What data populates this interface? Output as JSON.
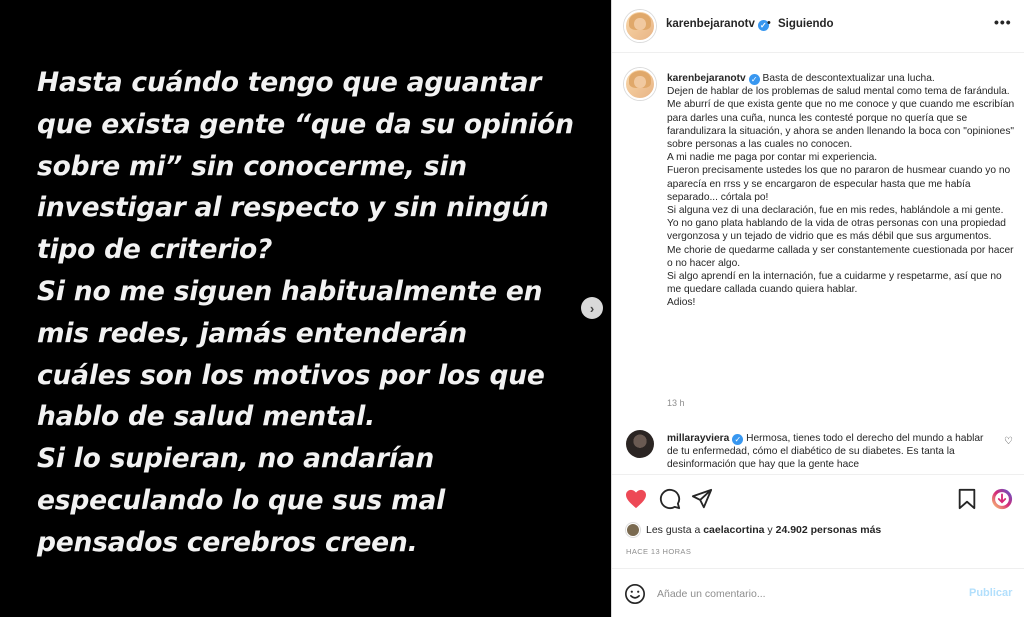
{
  "media": {
    "text_lines": [
      "Hasta cuándo tengo que aguantar",
      "que exista gente “que da su opinión",
      "sobre mi” sin conocerme, sin",
      "investigar al respecto y sin ningún",
      "tipo de criterio?",
      "Si no me siguen habitualmente en",
      "mis redes, jamás entenderán",
      "cuáles son los motivos por los que",
      "hablo de salud mental.",
      "Si lo supieran, no andarían",
      "especulando lo que sus mal",
      "pensados cerebros creen."
    ],
    "next_icon": "chevron-right-icon"
  },
  "header": {
    "username": "karenbejaranotv",
    "separator": "•",
    "follow_label": "Siguiendo",
    "more_label": "•••"
  },
  "caption": {
    "username": "karenbejaranotv",
    "lines": [
      " Basta de descontextualizar una lucha.",
      "Dejen de hablar de los problemas de salud mental como tema de farándula.",
      "Me aburrí de que exista gente que no me conoce y que cuando me escribían para darles una cuña, nunca les contesté porque no quería que se farandulizara la situación, y ahora se anden llenando la boca con \"opiniones\" sobre personas a las cuales no conocen.",
      "A mi nadie me paga por contar mi experiencia.",
      "Fueron precisamente ustedes los que no pararon de husmear cuando yo no aparecía en rrss y se encargaron de especular hasta que me había separado... córtala po!",
      "Si alguna vez di una declaración, fue en mis redes, hablándole a mi gente.",
      "Yo no gano plata hablando de la vida de otras personas con una propiedad vergonzosa y un tejado de vidrio que es más débil que sus argumentos.",
      "Me chorie de quedarme callada y ser constantemente cuestionada por hacer o no hacer algo.",
      "Si algo aprendí en la internación, fue a cuidarme y respetarme, así que no me quedare callada cuando quiera hablar.",
      "Adios!"
    ],
    "time": "13 h"
  },
  "comment": {
    "username": "millarayviera",
    "text": " Hermosa, tienes todo el derecho del mundo a hablar de tu enfermedad, cómo el diabético de su diabetes. Es tanta la desinformación que hay que la gente hace"
  },
  "likes": {
    "prefix": "Les gusta a ",
    "user": "caelacortina",
    "middle": " y ",
    "count": "24.902 personas más"
  },
  "time_ago": "HACE 13 HORAS",
  "comment_box": {
    "placeholder": "Añade un comentario...",
    "publish_label": "Publicar"
  },
  "colors": {
    "like_red": "#ed4956",
    "verified_blue": "#3897f0",
    "publish_disabled": "#b2dffc"
  }
}
